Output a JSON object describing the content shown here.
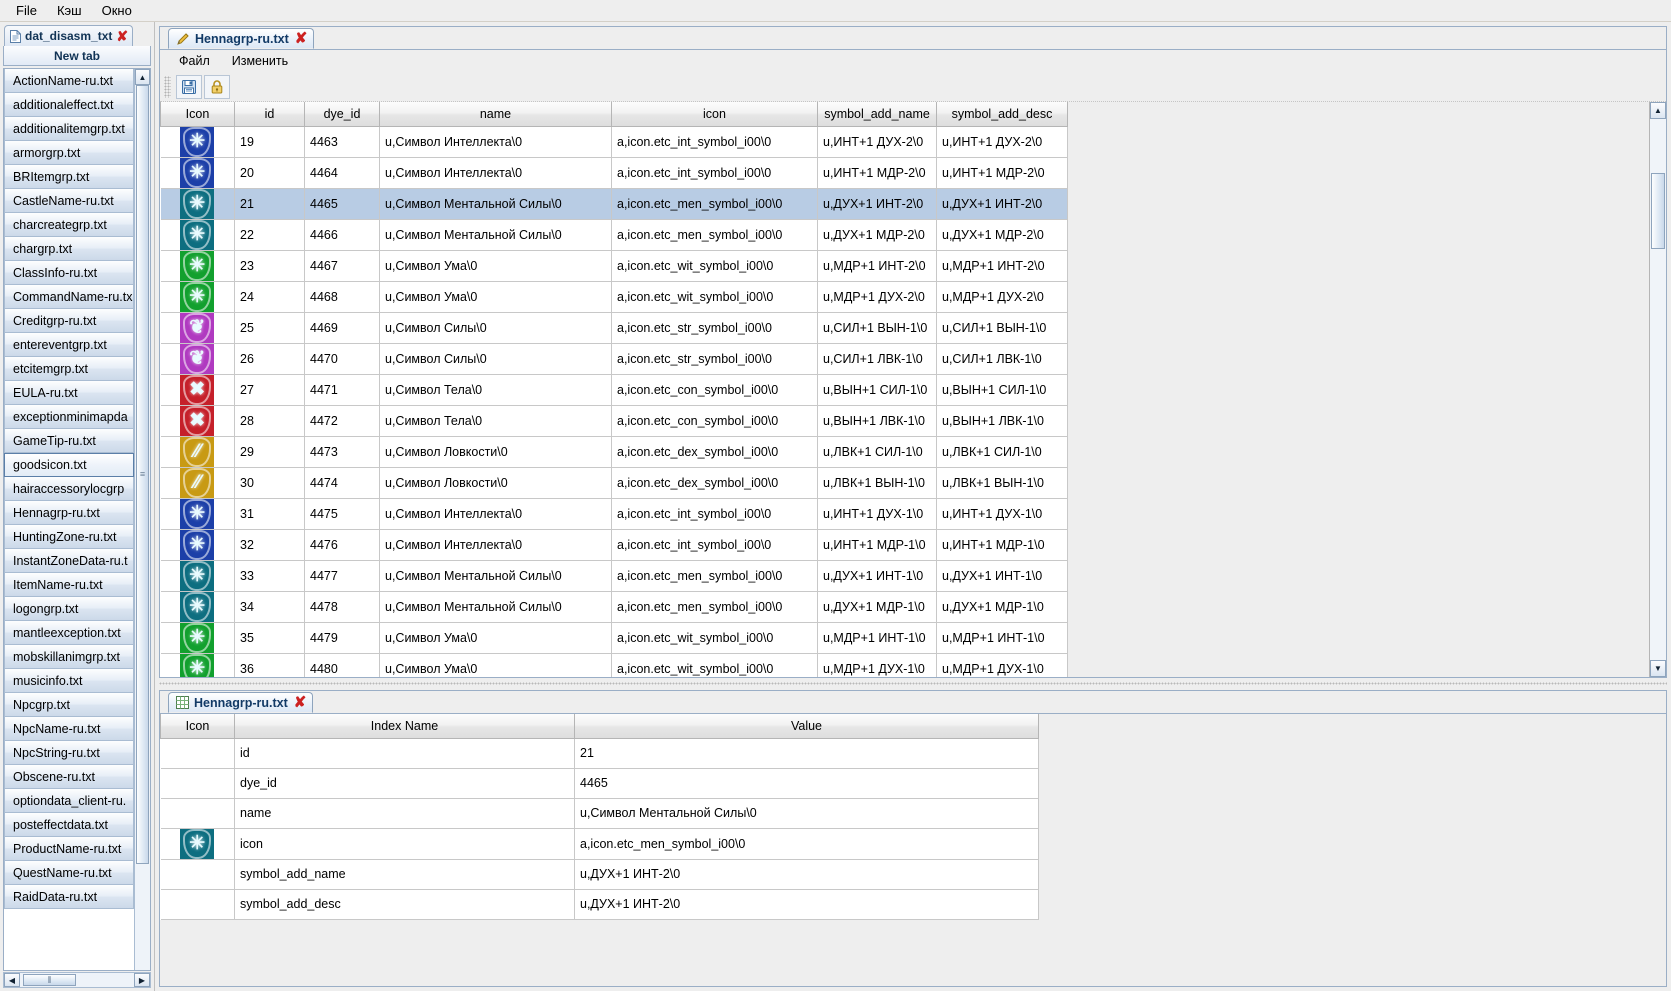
{
  "menubar": {
    "items": [
      {
        "label": "File",
        "name": "menu-file"
      },
      {
        "label": "Кэш",
        "name": "menu-cache"
      },
      {
        "label": "Окно",
        "name": "menu-window"
      }
    ]
  },
  "sidebar": {
    "tab": {
      "label": "dat_disasm_txt",
      "close": "✘",
      "icon": "document-icon"
    },
    "new_tab_label": "New tab",
    "files": [
      {
        "label": "ActionName-ru.txt",
        "selected": false
      },
      {
        "label": "additionaleffect.txt",
        "selected": false
      },
      {
        "label": "additionalitemgrp.txt",
        "selected": false
      },
      {
        "label": "armorgrp.txt",
        "selected": false
      },
      {
        "label": "BRItemgrp.txt",
        "selected": false
      },
      {
        "label": "CastleName-ru.txt",
        "selected": false
      },
      {
        "label": "charcreategrp.txt",
        "selected": false
      },
      {
        "label": "chargrp.txt",
        "selected": false
      },
      {
        "label": "ClassInfo-ru.txt",
        "selected": false
      },
      {
        "label": "CommandName-ru.tx",
        "selected": false
      },
      {
        "label": "Creditgrp-ru.txt",
        "selected": false
      },
      {
        "label": "entereventgrp.txt",
        "selected": false
      },
      {
        "label": "etcitemgrp.txt",
        "selected": false
      },
      {
        "label": "EULA-ru.txt",
        "selected": false
      },
      {
        "label": "exceptionminimapda",
        "selected": false
      },
      {
        "label": "GameTip-ru.txt",
        "selected": false
      },
      {
        "label": "goodsicon.txt",
        "selected": true
      },
      {
        "label": "hairaccessorylocgrp",
        "selected": false
      },
      {
        "label": "Hennagrp-ru.txt",
        "selected": false
      },
      {
        "label": "HuntingZone-ru.txt",
        "selected": false
      },
      {
        "label": "InstantZoneData-ru.t",
        "selected": false
      },
      {
        "label": "ItemName-ru.txt",
        "selected": false
      },
      {
        "label": "logongrp.txt",
        "selected": false
      },
      {
        "label": "mantleexception.txt",
        "selected": false
      },
      {
        "label": "mobskillanimgrp.txt",
        "selected": false
      },
      {
        "label": "musicinfo.txt",
        "selected": false
      },
      {
        "label": "Npcgrp.txt",
        "selected": false
      },
      {
        "label": "NpcName-ru.txt",
        "selected": false
      },
      {
        "label": "NpcString-ru.txt",
        "selected": false
      },
      {
        "label": "Obscene-ru.txt",
        "selected": false
      },
      {
        "label": "optiondata_client-ru.",
        "selected": false
      },
      {
        "label": "posteffectdata.txt",
        "selected": false
      },
      {
        "label": "ProductName-ru.txt",
        "selected": false
      },
      {
        "label": "QuestName-ru.txt",
        "selected": false
      },
      {
        "label": "RaidData-ru.txt",
        "selected": false
      }
    ]
  },
  "editor": {
    "tab": {
      "label": "Hennagrp-ru.txt",
      "close": "✘",
      "icon": "pencil-icon"
    },
    "menu": [
      {
        "label": "Файл",
        "name": "editor-menu-file"
      },
      {
        "label": "Изменить",
        "name": "editor-menu-edit"
      }
    ],
    "toolbar": [
      {
        "name": "save-button",
        "title": "save-icon"
      },
      {
        "name": "lock-button",
        "title": "lock-icon"
      }
    ],
    "columns": [
      "Icon",
      "id",
      "dye_id",
      "name",
      "icon",
      "symbol_add_name",
      "symbol_add_desc"
    ],
    "rows": [
      {
        "icon": "men-int-symbol",
        "color": "#1c3fa8",
        "glyph": "✳",
        "id": "19",
        "dye_id": "4463",
        "name": "u,Символ Интеллекта\\0",
        "iconpath": "a,icon.etc_int_symbol_i00\\0",
        "sym_name": "u,ИНТ+1 ДУХ-2\\0",
        "sym_desc": "u,ИНТ+1 ДУХ-2\\0",
        "selected": false
      },
      {
        "icon": "men-int-symbol",
        "color": "#1c3fa8",
        "glyph": "✳",
        "id": "20",
        "dye_id": "4464",
        "name": "u,Символ Интеллекта\\0",
        "iconpath": "a,icon.etc_int_symbol_i00\\0",
        "sym_name": "u,ИНТ+1 МДР-2\\0",
        "sym_desc": "u,ИНТ+1 МДР-2\\0",
        "selected": false
      },
      {
        "icon": "men-symbol",
        "color": "#0d6e80",
        "glyph": "✳",
        "id": "21",
        "dye_id": "4465",
        "name": "u,Символ Ментальной Силы\\0",
        "iconpath": "a,icon.etc_men_symbol_i00\\0",
        "sym_name": "u,ДУХ+1 ИНТ-2\\0",
        "sym_desc": "u,ДУХ+1 ИНТ-2\\0",
        "selected": true
      },
      {
        "icon": "men-symbol",
        "color": "#0d6e80",
        "glyph": "✳",
        "id": "22",
        "dye_id": "4466",
        "name": "u,Символ Ментальной Силы\\0",
        "iconpath": "a,icon.etc_men_symbol_i00\\0",
        "sym_name": "u,ДУХ+1 МДР-2\\0",
        "sym_desc": "u,ДУХ+1 МДР-2\\0",
        "selected": false
      },
      {
        "icon": "wit-symbol",
        "color": "#12a02e",
        "glyph": "✳",
        "id": "23",
        "dye_id": "4467",
        "name": "u,Символ Ума\\0",
        "iconpath": "a,icon.etc_wit_symbol_i00\\0",
        "sym_name": "u,МДР+1 ИНТ-2\\0",
        "sym_desc": "u,МДР+1 ИНТ-2\\0",
        "selected": false
      },
      {
        "icon": "wit-symbol",
        "color": "#12a02e",
        "glyph": "✳",
        "id": "24",
        "dye_id": "4468",
        "name": "u,Символ Ума\\0",
        "iconpath": "a,icon.etc_wit_symbol_i00\\0",
        "sym_name": "u,МДР+1 ДУХ-2\\0",
        "sym_desc": "u,МДР+1 ДУХ-2\\0",
        "selected": false
      },
      {
        "icon": "str-symbol",
        "color": "#b03ac0",
        "glyph": "❦",
        "id": "25",
        "dye_id": "4469",
        "name": "u,Символ Силы\\0",
        "iconpath": "a,icon.etc_str_symbol_i00\\0",
        "sym_name": "u,СИЛ+1 ВЫН-1\\0",
        "sym_desc": "u,СИЛ+1 ВЫН-1\\0",
        "selected": false
      },
      {
        "icon": "str-symbol",
        "color": "#b03ac0",
        "glyph": "❦",
        "id": "26",
        "dye_id": "4470",
        "name": "u,Символ Силы\\0",
        "iconpath": "a,icon.etc_str_symbol_i00\\0",
        "sym_name": "u,СИЛ+1 ЛВК-1\\0",
        "sym_desc": "u,СИЛ+1 ЛВК-1\\0",
        "selected": false
      },
      {
        "icon": "con-symbol",
        "color": "#c5202a",
        "glyph": "✖",
        "id": "27",
        "dye_id": "4471",
        "name": "u,Символ Тела\\0",
        "iconpath": "a,icon.etc_con_symbol_i00\\0",
        "sym_name": "u,ВЫН+1 СИЛ-1\\0",
        "sym_desc": "u,ВЫН+1 СИЛ-1\\0",
        "selected": false
      },
      {
        "icon": "con-symbol",
        "color": "#c5202a",
        "glyph": "✖",
        "id": "28",
        "dye_id": "4472",
        "name": "u,Символ Тела\\0",
        "iconpath": "a,icon.etc_con_symbol_i00\\0",
        "sym_name": "u,ВЫН+1 ЛВК-1\\0",
        "sym_desc": "u,ВЫН+1 ЛВК-1\\0",
        "selected": false
      },
      {
        "icon": "dex-symbol",
        "color": "#c89a14",
        "glyph": "⁄⁄",
        "id": "29",
        "dye_id": "4473",
        "name": "u,Символ Ловкости\\0",
        "iconpath": "a,icon.etc_dex_symbol_i00\\0",
        "sym_name": "u,ЛВК+1 СИЛ-1\\0",
        "sym_desc": "u,ЛВК+1 СИЛ-1\\0",
        "selected": false
      },
      {
        "icon": "dex-symbol",
        "color": "#c89a14",
        "glyph": "⁄⁄",
        "id": "30",
        "dye_id": "4474",
        "name": "u,Символ Ловкости\\0",
        "iconpath": "a,icon.etc_dex_symbol_i00\\0",
        "sym_name": "u,ЛВК+1 ВЫН-1\\0",
        "sym_desc": "u,ЛВК+1 ВЫН-1\\0",
        "selected": false
      },
      {
        "icon": "int-symbol",
        "color": "#1c3fa8",
        "glyph": "✳",
        "id": "31",
        "dye_id": "4475",
        "name": "u,Символ Интеллекта\\0",
        "iconpath": "a,icon.etc_int_symbol_i00\\0",
        "sym_name": "u,ИНТ+1 ДУХ-1\\0",
        "sym_desc": "u,ИНТ+1 ДУХ-1\\0",
        "selected": false
      },
      {
        "icon": "int-symbol",
        "color": "#1c3fa8",
        "glyph": "✳",
        "id": "32",
        "dye_id": "4476",
        "name": "u,Символ Интеллекта\\0",
        "iconpath": "a,icon.etc_int_symbol_i00\\0",
        "sym_name": "u,ИНТ+1 МДР-1\\0",
        "sym_desc": "u,ИНТ+1 МДР-1\\0",
        "selected": false
      },
      {
        "icon": "men-symbol",
        "color": "#0d6e80",
        "glyph": "✳",
        "id": "33",
        "dye_id": "4477",
        "name": "u,Символ Ментальной Силы\\0",
        "iconpath": "a,icon.etc_men_symbol_i00\\0",
        "sym_name": "u,ДУХ+1 ИНТ-1\\0",
        "sym_desc": "u,ДУХ+1 ИНТ-1\\0",
        "selected": false
      },
      {
        "icon": "men-symbol",
        "color": "#0d6e80",
        "glyph": "✳",
        "id": "34",
        "dye_id": "4478",
        "name": "u,Символ Ментальной Силы\\0",
        "iconpath": "a,icon.etc_men_symbol_i00\\0",
        "sym_name": "u,ДУХ+1 МДР-1\\0",
        "sym_desc": "u,ДУХ+1 МДР-1\\0",
        "selected": false
      },
      {
        "icon": "wit-symbol",
        "color": "#12a02e",
        "glyph": "✳",
        "id": "35",
        "dye_id": "4479",
        "name": "u,Символ Ума\\0",
        "iconpath": "a,icon.etc_wit_symbol_i00\\0",
        "sym_name": "u,МДР+1 ИНТ-1\\0",
        "sym_desc": "u,МДР+1 ИНТ-1\\0",
        "selected": false
      },
      {
        "icon": "wit-symbol",
        "color": "#12a02e",
        "glyph": "✳",
        "id": "36",
        "dye_id": "4480",
        "name": "u,Символ Ума\\0",
        "iconpath": "a,icon.etc_wit_symbol_i00\\0",
        "sym_name": "u,МДР+1 ДУХ-1\\0",
        "sym_desc": "u,МДР+1 ДУХ-1\\0",
        "selected": false
      },
      {
        "icon": "str-symbol",
        "color": "#b03ac0",
        "glyph": "❦",
        "id": "",
        "dye_id": "",
        "name": "",
        "iconpath": "",
        "sym_name": "",
        "sym_desc": "",
        "selected": false
      }
    ]
  },
  "detail": {
    "tab": {
      "label": "Hennagrp-ru.txt",
      "close": "✘",
      "icon": "grid-icon"
    },
    "columns": [
      "Icon",
      "Index Name",
      "Value"
    ],
    "rows": [
      {
        "index_name": "id",
        "value": "21",
        "has_icon": false
      },
      {
        "index_name": "dye_id",
        "value": "4465",
        "has_icon": false
      },
      {
        "index_name": "name",
        "value": "u,Символ Ментальной Силы\\0",
        "has_icon": false
      },
      {
        "index_name": "icon",
        "value": "a,icon.etc_men_symbol_i00\\0",
        "has_icon": true,
        "color": "#0d6e80",
        "glyph": "✳"
      },
      {
        "index_name": "symbol_add_name",
        "value": "u,ДУХ+1 ИНТ-2\\0",
        "has_icon": false
      },
      {
        "index_name": "symbol_add_desc",
        "value": "u,ДУХ+1 ИНТ-2\\0",
        "has_icon": false
      }
    ]
  },
  "colors": {
    "selection": "#b8cce4",
    "tab_text": "#123a66",
    "close_x": "#cc2222"
  }
}
